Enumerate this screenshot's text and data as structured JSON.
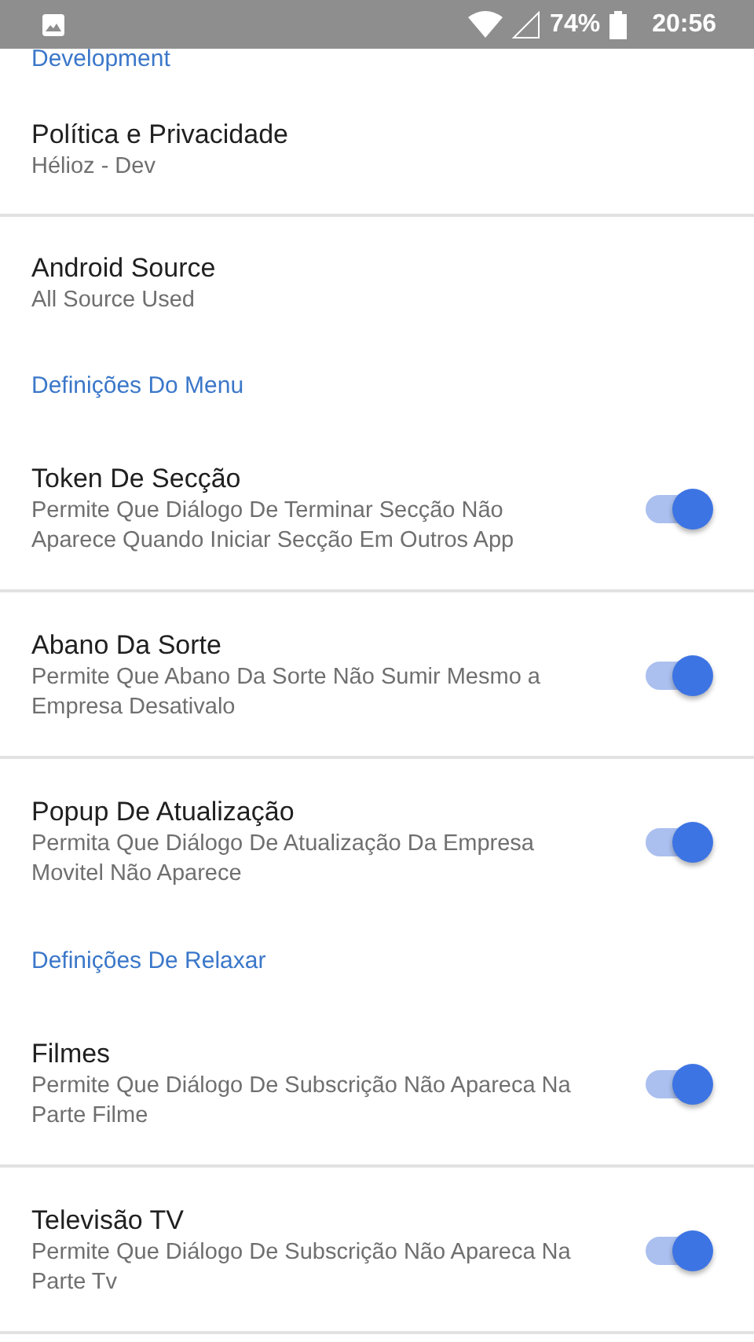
{
  "status_bar": {
    "battery": "74%",
    "time": "20:56"
  },
  "sections": [
    {
      "header": "Development",
      "items": [
        {
          "kind": "text",
          "title": "Política e Privacidade",
          "subtitle": "Hélioz - Dev",
          "divider": true
        },
        {
          "kind": "text",
          "title": "Android Source",
          "subtitle": "All Source Used",
          "divider": false
        }
      ]
    },
    {
      "header": "Definições Do Menu",
      "items": [
        {
          "kind": "switch",
          "title": "Token De Secção",
          "subtitle": "Permite Que Diálogo De Terminar Secção Não Aparece Quando Iniciar Secção Em Outros App",
          "on": true,
          "divider": true
        },
        {
          "kind": "switch",
          "title": "Abano Da Sorte",
          "subtitle": "Permite Que Abano Da Sorte Não Sumir Mesmo a Empresa Desativalo",
          "on": true,
          "divider": true
        },
        {
          "kind": "switch",
          "title": "Popup De Atualização",
          "subtitle": "Permita Que Diálogo De Atualização Da Empresa Movitel Não Aparece",
          "on": true,
          "divider": false
        }
      ]
    },
    {
      "header": "Definições De Relaxar",
      "items": [
        {
          "kind": "switch",
          "title": "Filmes",
          "subtitle": "Permite Que Diálogo De Subscrição Não Apareca Na Parte Filme",
          "on": true,
          "divider": true
        },
        {
          "kind": "switch",
          "title": "Televisão TV",
          "subtitle": "Permite Que Diálogo De Subscrição Não Apareca Na Parte Tv",
          "on": true,
          "divider": true
        }
      ]
    }
  ]
}
